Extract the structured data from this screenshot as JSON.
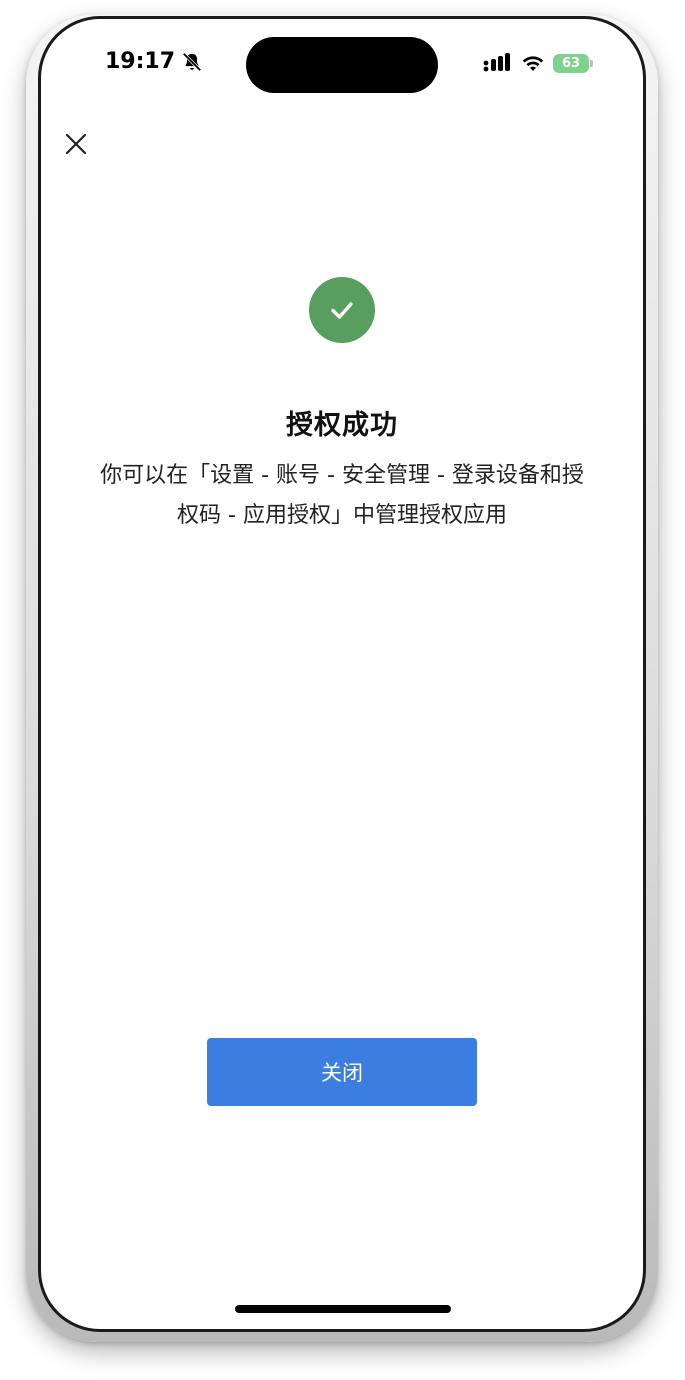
{
  "status_bar": {
    "time": "19:17",
    "battery_level": "63",
    "battery_color": "#7fd28e",
    "icons": [
      "bell-muted-icon",
      "signal-icon",
      "wifi-icon",
      "battery-charging-icon"
    ]
  },
  "dialog": {
    "close_icon": "close-icon",
    "success_icon": "checkmark-circle-icon",
    "success_color": "#579e5f",
    "title": "授权成功",
    "description": "你可以在「设置 - 账号 - 安全管理 - 登录设备和授权码 - 应用授权」中管理授权应用",
    "close_button_label": "关闭",
    "button_color": "#3b7ee0"
  }
}
